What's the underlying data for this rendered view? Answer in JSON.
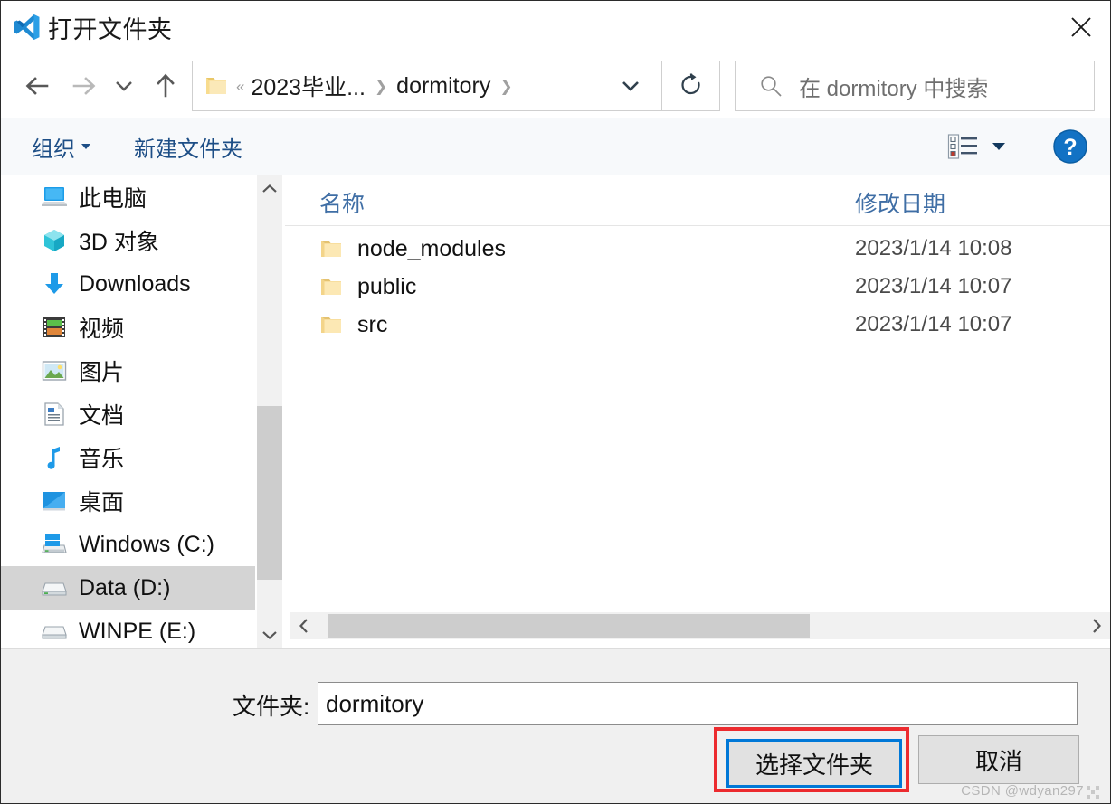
{
  "window": {
    "title": "打开文件夹",
    "app_icon": "vscode-icon",
    "close_label": "✕"
  },
  "nav": {
    "back_icon": "arrow-left-icon",
    "forward_icon": "arrow-right-icon",
    "recent_icon": "chevron-down-icon",
    "up_icon": "arrow-up-icon",
    "refresh_icon": "refresh-icon"
  },
  "address": {
    "folder_icon": "folder-icon",
    "overflow": "«",
    "separator": "❯",
    "crumbs": [
      {
        "label": "2023毕业..."
      },
      {
        "label": "dormitory"
      }
    ],
    "dropdown_icon": "chevron-down-icon"
  },
  "search": {
    "icon": "search-icon",
    "placeholder": "在 dormitory 中搜索"
  },
  "toolbar": {
    "organize_label": "组织",
    "new_folder_label": "新建文件夹",
    "view_icon": "list-view-icon",
    "view_caret_icon": "caret-down-icon",
    "help_icon": "help-question-icon"
  },
  "sidebar": {
    "items": [
      {
        "label": "此电脑",
        "icon": "computer-icon",
        "level": 0,
        "selected": false
      },
      {
        "label": "3D 对象",
        "icon": "cube-3d-icon",
        "level": 1,
        "selected": false
      },
      {
        "label": "Downloads",
        "icon": "download-icon",
        "level": 1,
        "selected": false
      },
      {
        "label": "视频",
        "icon": "video-icon",
        "level": 1,
        "selected": false
      },
      {
        "label": "图片",
        "icon": "picture-icon",
        "level": 1,
        "selected": false
      },
      {
        "label": "文档",
        "icon": "document-icon",
        "level": 1,
        "selected": false
      },
      {
        "label": "音乐",
        "icon": "music-note-icon",
        "level": 1,
        "selected": false
      },
      {
        "label": "桌面",
        "icon": "desktop-icon",
        "level": 1,
        "selected": false
      },
      {
        "label": "Windows (C:)",
        "icon": "windows-drive-icon",
        "level": 1,
        "selected": false
      },
      {
        "label": "Data (D:)",
        "icon": "drive-icon",
        "level": 1,
        "selected": true
      },
      {
        "label": "WINPE (E:)",
        "icon": "drive-icon",
        "level": 1,
        "selected": false
      }
    ],
    "scroll_up_icon": "chevron-up-icon",
    "scroll_down_icon": "chevron-down-icon"
  },
  "filelist": {
    "sort_indicator_icon": "sort-ascending-caret-icon",
    "columns": [
      {
        "key": "name",
        "label": "名称"
      },
      {
        "key": "date",
        "label": "修改日期"
      }
    ],
    "rows": [
      {
        "icon": "folder-icon",
        "name": "node_modules",
        "date": "2023/1/14 10:08"
      },
      {
        "icon": "folder-icon",
        "name": "public",
        "date": "2023/1/14 10:07"
      },
      {
        "icon": "folder-icon",
        "name": "src",
        "date": "2023/1/14 10:07"
      }
    ],
    "hscroll_left_icon": "chevron-left-icon",
    "hscroll_right_icon": "chevron-right-icon"
  },
  "footer": {
    "folder_label": "文件夹:",
    "folder_value": "dormitory",
    "select_label": "选择文件夹",
    "cancel_label": "取消"
  },
  "watermark": {
    "text": "CSDN @wdyan297"
  },
  "colors": {
    "accent_blue": "#0078d7",
    "annotation_red": "#ec2b2f",
    "toolbar_link": "#1d4e86",
    "column_header": "#3f6ea5",
    "selection_gray": "#d4d4d4",
    "folder_yellow": "#fcd77f",
    "footer_bg": "#f0f0f0"
  }
}
